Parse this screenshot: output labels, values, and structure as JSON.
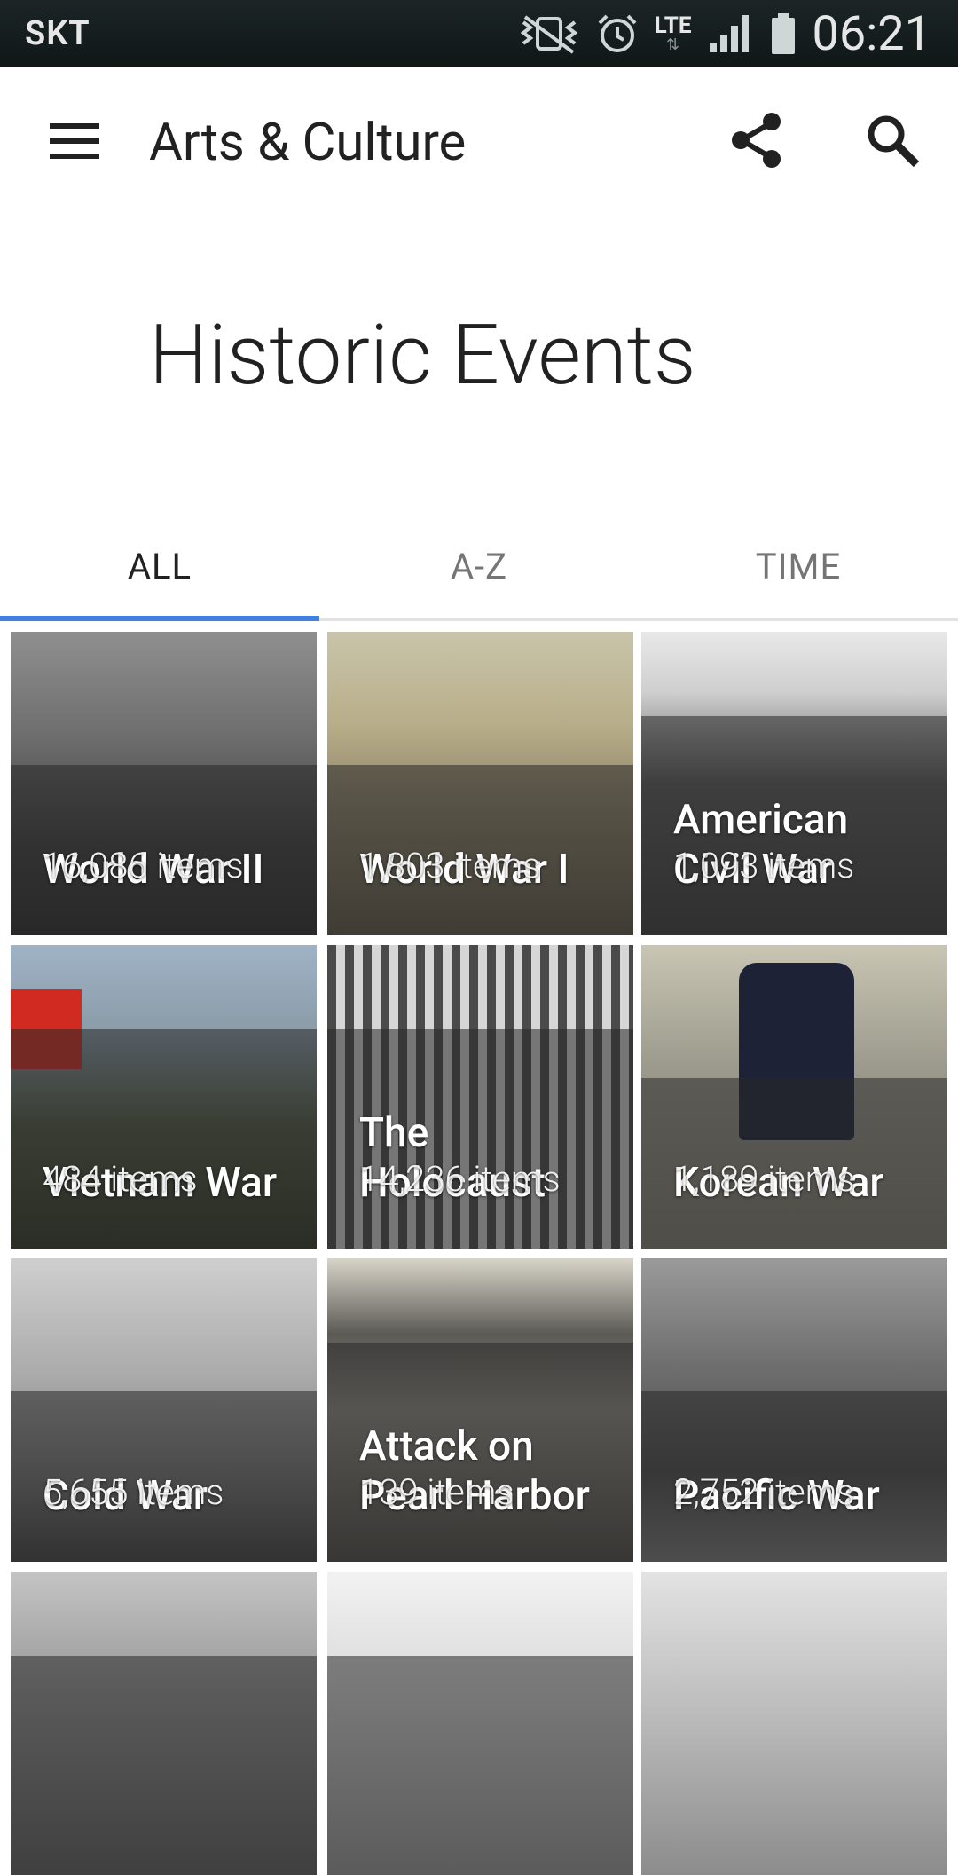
{
  "status_bar": {
    "carrier": "SKT",
    "network": "LTE",
    "time": "06:21",
    "icons": [
      "vibrate-mute-icon",
      "alarm-icon",
      "lte-icon",
      "signal-icon",
      "battery-icon"
    ]
  },
  "app_bar": {
    "title": "Arts & Culture",
    "icons": [
      "menu-icon",
      "share-icon",
      "search-icon"
    ]
  },
  "page": {
    "title": "Historic Events"
  },
  "tabs": [
    {
      "label": "ALL",
      "active": true
    },
    {
      "label": "A-Z",
      "active": false
    },
    {
      "label": "TIME",
      "active": false
    }
  ],
  "accent_color": "#3f80e0",
  "cards": [
    {
      "title": "World War II",
      "count": "16,086 items"
    },
    {
      "title": "World War I",
      "count": "1,803 items"
    },
    {
      "title": "American Civil War",
      "count": "1,093 items"
    },
    {
      "title": "Vietnam War",
      "count": "484 items"
    },
    {
      "title": "The Holocaust",
      "count": "14,236 items"
    },
    {
      "title": "Korean War",
      "count": "1,189 items"
    },
    {
      "title": "Cold War",
      "count": "5,655 items"
    },
    {
      "title": "Attack on Pearl Harbor",
      "count": "139 items"
    },
    {
      "title": "Pacific War",
      "count": "2,752 items"
    },
    {
      "title": "",
      "count": ""
    },
    {
      "title": "",
      "count": ""
    },
    {
      "title": "",
      "count": ""
    }
  ]
}
